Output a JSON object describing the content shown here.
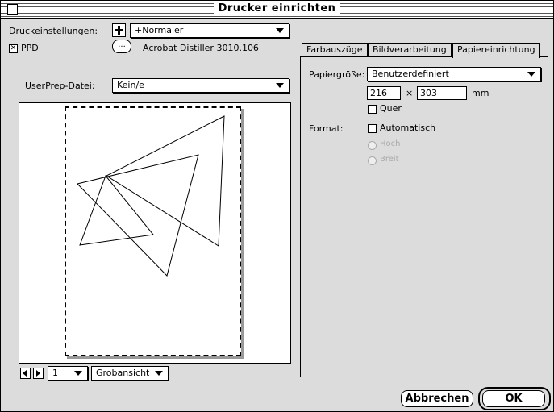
{
  "window": {
    "title": "Drucker einrichten"
  },
  "left": {
    "druckeinstellungen_label": "Druckeinstellungen:",
    "druckeinstellungen_value": "+Normaler",
    "ppd_checked": true,
    "ppd_label": "PPD",
    "ppd_button_label": "...",
    "ppd_name": "Acrobat Distiller 3010.106",
    "userprep_label": "UserPrep-Datei:",
    "userprep_value": "Kein/e"
  },
  "tabs": [
    "Farbauszüge",
    "Bildverarbeitung",
    "Papiereinrichtung"
  ],
  "active_tab": "Papiereinrichtung",
  "papier": {
    "size_label": "Papiergröße:",
    "size_value": "Benutzerdefiniert",
    "width": "216",
    "times": "×",
    "height": "303",
    "unit": "mm",
    "quer_label": "Quer",
    "quer_checked": false,
    "format_label": "Format:",
    "auto_label": "Automatisch",
    "auto_checked": false,
    "hoch_label": "Hoch",
    "breit_label": "Breit"
  },
  "bottom": {
    "page_value": "1",
    "view_value": "Grobansicht",
    "cancel_label": "Abbrechen",
    "ok_label": "OK"
  },
  "icons": {
    "plus": "plus-icon",
    "prev": "arrow-left-icon",
    "next": "arrow-right-icon",
    "dropdown": "triangle-down-icon"
  }
}
